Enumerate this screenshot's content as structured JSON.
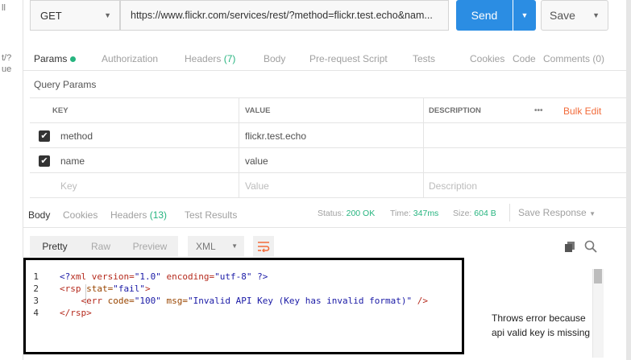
{
  "left_strip": {
    "texts": [
      "ll",
      "t/?",
      "ue"
    ]
  },
  "request": {
    "method": "GET",
    "url": "https://www.flickr.com/services/rest/?method=flickr.test.echo&nam...",
    "send_label": "Send",
    "save_label": "Save"
  },
  "request_tabs": {
    "params": "Params",
    "authorization": "Authorization",
    "headers": "Headers",
    "headers_count": "(7)",
    "body": "Body",
    "prerequest": "Pre-request Script",
    "tests": "Tests",
    "cookies": "Cookies",
    "code": "Code",
    "comments": "Comments (0)"
  },
  "query_params": {
    "title": "Query Params",
    "columns": {
      "key": "KEY",
      "value": "VALUE",
      "description": "DESCRIPTION",
      "more": "•••",
      "bulk_edit": "Bulk Edit"
    },
    "rows": [
      {
        "checked": true,
        "key": "method",
        "value": "flickr.test.echo",
        "description": ""
      },
      {
        "checked": true,
        "key": "name",
        "value": "value",
        "description": ""
      }
    ],
    "placeholders": {
      "key": "Key",
      "value": "Value",
      "description": "Description"
    }
  },
  "response_tabs": {
    "body": "Body",
    "cookies": "Cookies",
    "headers": "Headers",
    "headers_count": "(13)",
    "test_results": "Test Results",
    "status_label": "Status:",
    "status_value": "200 OK",
    "time_label": "Time:",
    "time_value": "347ms",
    "size_label": "Size:",
    "size_value": "604 B",
    "save_response": "Save Response"
  },
  "view": {
    "pretty": "Pretty",
    "raw": "Raw",
    "preview": "Preview",
    "format": "XML"
  },
  "code": {
    "line_numbers": [
      "1",
      "2",
      "3",
      "4"
    ],
    "l1_a": "<?",
    "l1_b": "xml version=",
    "l1_c": "\"1.0\"",
    "l1_d": " encoding=",
    "l1_e": "\"utf-8\"",
    "l1_f": " ?>",
    "l2_a": "<rsp",
    "l2_b": " stat=",
    "l2_c": "\"fail\"",
    "l2_d": ">",
    "l3_a": "<err",
    "l3_b": " code=",
    "l3_c": "\"100\"",
    "l3_d": " msg=",
    "l3_e": "\"Invalid API Key (Key has invalid format)\"",
    "l3_f": " />",
    "l4_a": "</rsp>"
  },
  "annotation": {
    "line1": "Throws error because",
    "line2": "api valid key is missing"
  },
  "colors": {
    "accent_blue": "#2b8de3",
    "green": "#26b47f",
    "orange": "#f26b3a"
  }
}
